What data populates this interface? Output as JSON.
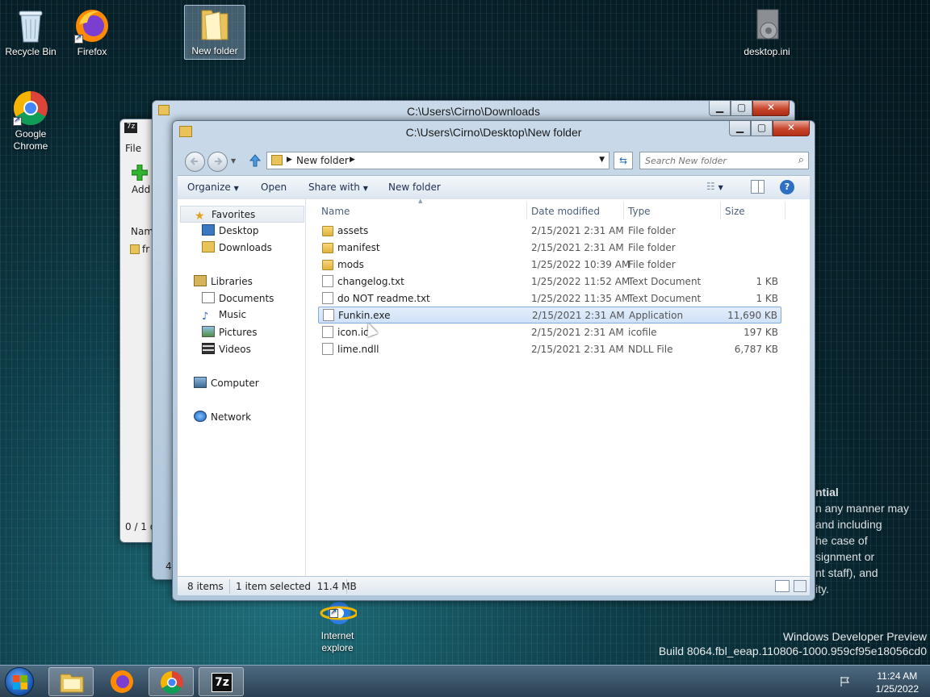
{
  "desktop": {
    "icons": [
      {
        "label": "Recycle Bin"
      },
      {
        "label": "Firefox"
      },
      {
        "label": "New folder"
      },
      {
        "label": "desktop.ini"
      },
      {
        "label": "Google Chrome"
      },
      {
        "label": "Internet explore"
      }
    ],
    "watermark": {
      "line1": "Windows Developer Preview",
      "line2": "Build 8064.fbl_eeap.110806-1000.959cf95e18056cd0"
    },
    "legal_lines": [
      "ntial",
      "n any manner may",
      " and including",
      "he case of",
      "signment or",
      "nt staff), and",
      "ity."
    ]
  },
  "back_windows": {
    "sevenzip": {
      "menu_file": "File",
      "add_label": "Add",
      "col_name": "Nam",
      "item": "fr",
      "status": "0 / 1 o"
    },
    "downloads": {
      "title": "C:\\Users\\Cirno\\Downloads",
      "status": "4"
    }
  },
  "window": {
    "title": "C:\\Users\\Cirno\\Desktop\\New folder",
    "controls": {
      "minimize": "▁",
      "maximize": "▢",
      "close": "✕"
    },
    "address": {
      "crumb": "New folder"
    },
    "search": {
      "placeholder": "Search New folder"
    },
    "toolbar": {
      "organize": "Organize",
      "open": "Open",
      "share_with": "Share with",
      "new_folder": "New folder"
    },
    "nav": {
      "favorites": "Favorites",
      "desktop": "Desktop",
      "downloads": "Downloads",
      "libraries": "Libraries",
      "documents": "Documents",
      "music": "Music",
      "pictures": "Pictures",
      "videos": "Videos",
      "computer": "Computer",
      "network": "Network"
    },
    "columns": {
      "name": "Name",
      "date": "Date modified",
      "type": "Type",
      "size": "Size"
    },
    "files": [
      {
        "name": "assets",
        "date": "2/15/2021 2:31 AM",
        "type": "File folder",
        "size": "",
        "icon": "folder-icon"
      },
      {
        "name": "manifest",
        "date": "2/15/2021 2:31 AM",
        "type": "File folder",
        "size": "",
        "icon": "folder-icon"
      },
      {
        "name": "mods",
        "date": "1/25/2022 10:39 AM",
        "type": "File folder",
        "size": "",
        "icon": "folder-icon"
      },
      {
        "name": "changelog.txt",
        "date": "1/25/2022 11:52 AM",
        "type": "Text Document",
        "size": "1 KB",
        "icon": "text-file-icon"
      },
      {
        "name": "do NOT readme.txt",
        "date": "1/25/2022 11:35 AM",
        "type": "Text Document",
        "size": "1 KB",
        "icon": "text-file-icon"
      },
      {
        "name": "Funkin.exe",
        "date": "2/15/2021 2:31 AM",
        "type": "Application",
        "size": "11,690 KB",
        "icon": "application-icon",
        "selected": true
      },
      {
        "name": "icon.ico",
        "date": "2/15/2021 2:31 AM",
        "type": "icofile",
        "size": "197 KB",
        "icon": "file-icon"
      },
      {
        "name": "lime.ndll",
        "date": "2/15/2021 2:31 AM",
        "type": "NDLL File",
        "size": "6,787 KB",
        "icon": "file-icon"
      }
    ],
    "status": {
      "count": "8 items",
      "selection": "1 item selected  11.4 MB"
    }
  },
  "taskbar": {
    "clock_time": "11:24 AM",
    "clock_date": "1/25/2022",
    "apps": [
      "file-explorer-icon",
      "firefox-icon",
      "chrome-icon",
      "7zip-icon"
    ]
  }
}
